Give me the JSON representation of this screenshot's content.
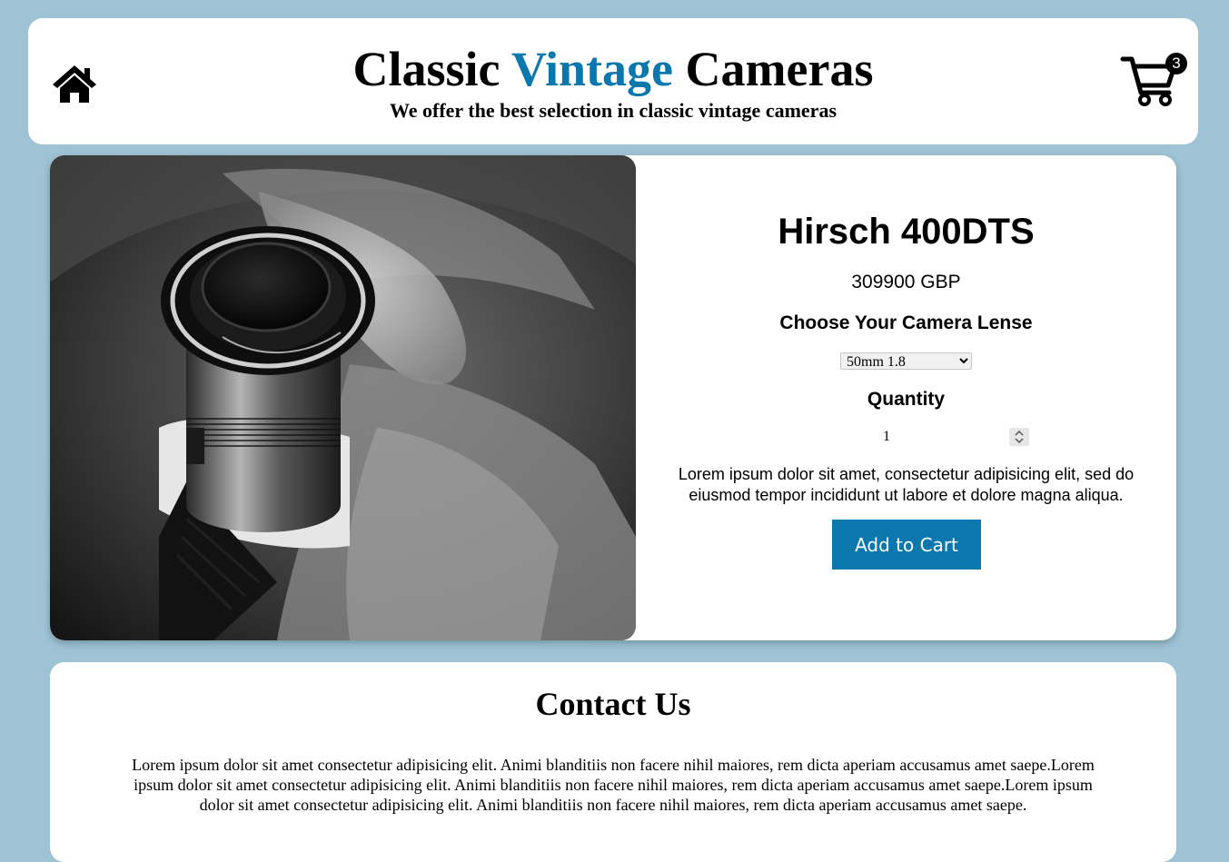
{
  "header": {
    "title_part1": "Classic ",
    "title_accent": "Vintage",
    "title_part2": " Cameras",
    "subtitle": "We offer the best selection in classic vintage cameras",
    "home_icon": "home-icon",
    "cart_icon": "shopping-cart-icon",
    "cart_count": "3"
  },
  "product": {
    "image": "black-and-white-vintage-camera-photo",
    "name": "Hirsch 400DTS",
    "price": "309900 GBP",
    "lens_label": "Choose Your Camera Lense",
    "lens_selected": "50mm 1.8",
    "quantity_label": "Quantity",
    "quantity_value": "1",
    "description": "Lorem ipsum dolor sit amet, consectetur adipisicing elit, sed do eiusmod tempor incididunt ut labore et dolore magna aliqua.",
    "add_to_cart_label": "Add to Cart"
  },
  "contact": {
    "title": "Contact Us",
    "text": "Lorem ipsum dolor sit amet consectetur adipisicing elit. Animi blanditiis non facere nihil maiores, rem dicta aperiam accusamus amet saepe.Lorem ipsum dolor sit amet consectetur adipisicing elit. Animi blanditiis non facere nihil maiores, rem dicta aperiam accusamus amet saepe.Lorem ipsum dolor sit amet consectetur adipisicing elit. Animi blanditiis non facere nihil maiores, rem dicta aperiam accusamus amet saepe."
  },
  "colors": {
    "background": "#9ec3d5",
    "accent": "#0a77ad",
    "card": "#ffffff"
  }
}
